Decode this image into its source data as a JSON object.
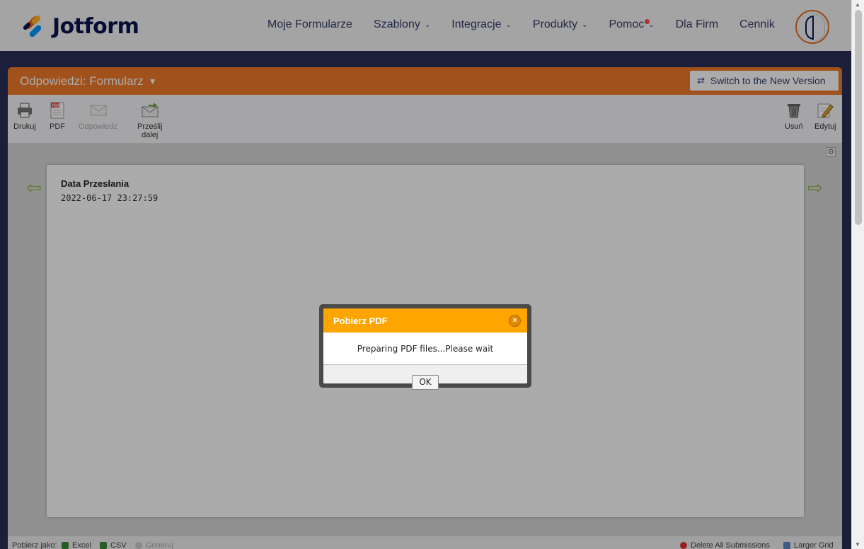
{
  "brand": {
    "name": "Jotform"
  },
  "nav": {
    "items": [
      {
        "label": "Moje Formularze",
        "has_dropdown": false
      },
      {
        "label": "Szablony",
        "has_dropdown": true
      },
      {
        "label": "Integracje",
        "has_dropdown": true
      },
      {
        "label": "Produkty",
        "has_dropdown": true
      },
      {
        "label": "Pomoc",
        "has_dropdown": true,
        "notification_dot": true
      },
      {
        "label": "Dla Firm",
        "has_dropdown": false
      },
      {
        "label": "Cennik",
        "has_dropdown": false
      }
    ]
  },
  "header": {
    "title": "Odpowiedzi: Formularz",
    "switch_button": "Switch to the New Version"
  },
  "toolbar": {
    "print": "Drukuj",
    "pdf": "PDF",
    "reply": "Odpowiedz",
    "forward_line1": "Prześlij",
    "forward_line2": "dalej",
    "delete": "Usuń",
    "edit": "Edytuj"
  },
  "submission": {
    "field_label": "Data Przesłania",
    "field_value": "2022-06-17 23:27:59"
  },
  "footer": {
    "download_as": "Pobierz jako:",
    "excel": "Excel",
    "csv": "CSV",
    "generate": "Generuj",
    "delete_all": "Delete All Submissions",
    "larger_grid": "Larger Grid"
  },
  "dialog": {
    "title": "Pobierz PDF",
    "message": "Preparing PDF files...Please wait",
    "ok": "OK"
  },
  "colors": {
    "orange_header": "#ef7a2b",
    "dialog_header": "#ffa500",
    "nav_text": "#343c6a",
    "page_bg": "#2b2f55"
  }
}
